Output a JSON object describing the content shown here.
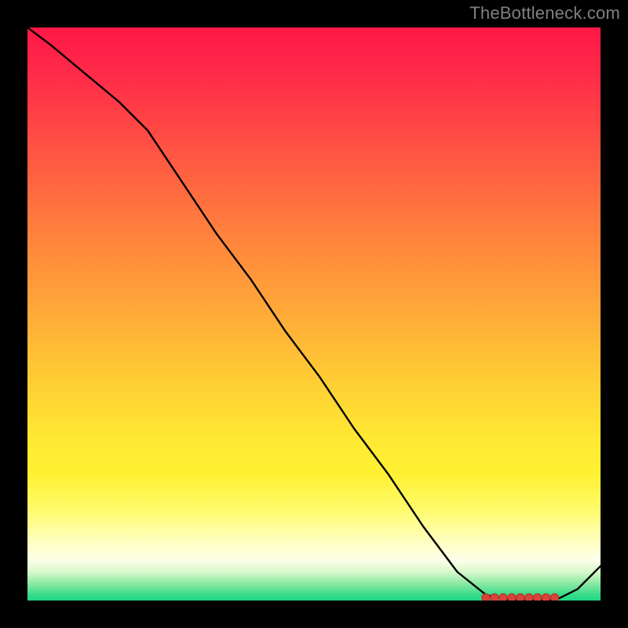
{
  "attribution": "TheBottleneck.com",
  "colors": {
    "curve": "#000000",
    "marker_fill": "#d9413b",
    "marker_stroke": "#b23128",
    "background": "#000000"
  },
  "chart_data": {
    "type": "line",
    "title": "",
    "xlabel": "",
    "ylabel": "",
    "xlim": [
      0,
      100
    ],
    "ylim": [
      0,
      100
    ],
    "x": [
      0,
      4,
      10,
      16,
      21,
      27,
      33,
      39,
      45,
      51,
      57,
      63,
      69,
      75,
      80,
      84,
      88,
      92,
      96,
      100
    ],
    "values": [
      100,
      97,
      92,
      87,
      82,
      73,
      64,
      56,
      47,
      39,
      30,
      22,
      13,
      5,
      1,
      0,
      0,
      0,
      2,
      6
    ],
    "markers_x": [
      80,
      81.5,
      83,
      84.5,
      86,
      87.5,
      89,
      90.5,
      92
    ],
    "markers_y": [
      0.5,
      0.5,
      0.5,
      0.5,
      0.5,
      0.5,
      0.5,
      0.5,
      0.5
    ]
  }
}
